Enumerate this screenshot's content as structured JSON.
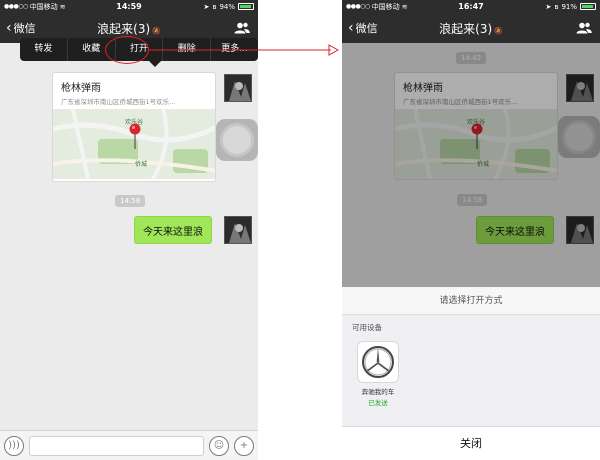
{
  "left": {
    "status": {
      "carrier": "中国移动",
      "time": "14:59",
      "battery": "94%",
      "battery_level": 0.94
    },
    "nav": {
      "back_label": "微信",
      "title": "浪起来(3)"
    },
    "menu": {
      "items": [
        "转发",
        "收藏",
        "打开",
        "删除",
        "更多..."
      ]
    },
    "location": {
      "title": "枪林弹雨",
      "address": "广东省深圳市南山区侨城西街1号欢乐...",
      "map_labels": [
        "欢乐谷",
        "侨城"
      ]
    },
    "time_divider": "14:58",
    "message": "今天来这里浪"
  },
  "right": {
    "status": {
      "carrier": "中国移动",
      "time": "16:47",
      "battery": "91%",
      "battery_level": 0.91
    },
    "nav": {
      "back_label": "微信",
      "title": "浪起来(3)"
    },
    "time_divider_top": "14:42",
    "location": {
      "title": "枪林弹雨",
      "address": "广东省深圳市南山区侨城西街1号欢乐...",
      "map_labels": [
        "欢乐谷",
        "侨城"
      ]
    },
    "time_divider": "14:58",
    "message": "今天来这里浪",
    "sheet": {
      "title": "请选择打开方式",
      "section": "可用设备",
      "device_name": "奔驰我的车",
      "device_status": "已发送",
      "close_label": "关闭"
    }
  },
  "colors": {
    "bar_dark": "#2d2d2d",
    "bubble_green": "#9fe658",
    "highlight_red": "#e02020",
    "sent_green": "#1aad19"
  }
}
